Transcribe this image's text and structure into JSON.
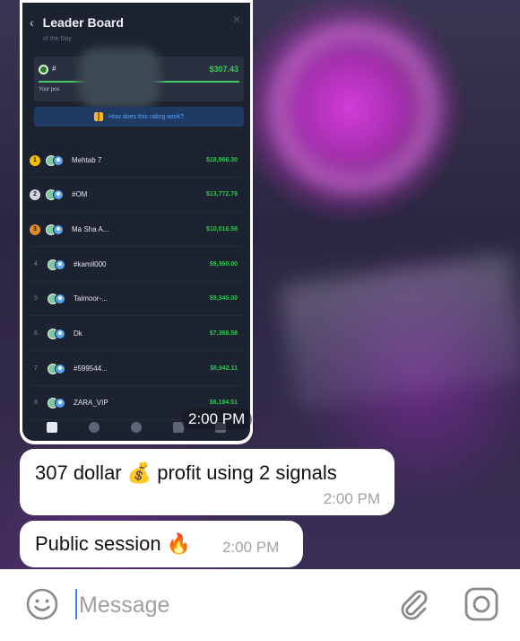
{
  "leaderboard": {
    "title": "Leader Board",
    "subtitle": "of the Day",
    "my_card": {
      "hash": "#",
      "amount": "$307.43",
      "position_label": "Your pos"
    },
    "help_text": "How does this rating work?",
    "rows": [
      {
        "rank": "1",
        "name": "Mehtab 7",
        "amount": "$18,966.30"
      },
      {
        "rank": "2",
        "name": "#OM",
        "amount": "$13,772.78"
      },
      {
        "rank": "3",
        "name": "Ma Sha A...",
        "amount": "$10,016.58"
      },
      {
        "rank": "4",
        "name": "#kamil000",
        "amount": "$9,360.00"
      },
      {
        "rank": "5",
        "name": "Taimoor-...",
        "amount": "$9,345.00"
      },
      {
        "rank": "6",
        "name": "Dk",
        "amount": "$7,368.58"
      },
      {
        "rank": "7",
        "name": "#599544...",
        "amount": "$6,942.11"
      },
      {
        "rank": "8",
        "name": "ZARA_VIP",
        "amount": "$6,184.51"
      }
    ],
    "image_time": "2:00 PM"
  },
  "messages": [
    {
      "text": "307 dollar 💰 profit using 2 signals",
      "time": "2:00 PM"
    },
    {
      "text": "Public session 🔥",
      "time": "2:00 PM"
    }
  ],
  "input": {
    "placeholder": "Message"
  },
  "icons": {
    "emoji": "smiley-icon",
    "attach": "paperclip-icon",
    "camera": "instagram-camera-icon"
  },
  "colors": {
    "profit_green": "#35c257",
    "help_blue": "#4ea3ff",
    "cursor_blue": "#3b8cf0"
  }
}
